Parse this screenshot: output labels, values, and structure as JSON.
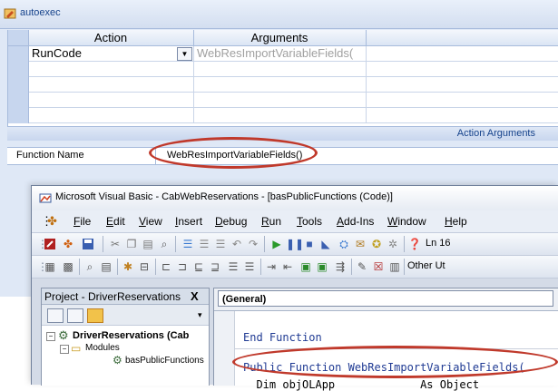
{
  "macro_window": {
    "title": "autoexec",
    "grid": {
      "headers": [
        "Action",
        "Arguments"
      ],
      "rows": [
        {
          "action": "RunCode",
          "arguments": "WebResImportVariableFields("
        }
      ]
    },
    "action_arguments_label": "Action Arguments",
    "function_name_label": "Function Name",
    "function_name_value": "WebResImportVariableFields()"
  },
  "vbe": {
    "title": "Microsoft Visual Basic - CabWebReservations - [basPublicFunctions (Code)]",
    "menu": [
      "File",
      "Edit",
      "View",
      "Insert",
      "Debug",
      "Run",
      "Tools",
      "Add-Ins",
      "Window",
      "Help"
    ],
    "menu_underlines": [
      "F",
      "E",
      "V",
      "I",
      "D",
      "R",
      "T",
      "A",
      "W",
      "H"
    ],
    "toolbar_status": "Ln 16",
    "toolbar2_label": "Other Ut",
    "project_panel": {
      "title": "Project - DriverReservations",
      "close_label": "X",
      "root": "DriverReservations (Cab",
      "folder": "Modules",
      "module": "basPublicFunctions"
    },
    "code": {
      "object_dropdown": "(General)",
      "lines": [
        "End Function",
        "Public Function WebResImportVariableFields(",
        "  Dim objOLApp             As Object"
      ]
    }
  },
  "colors": {
    "highlight_oval": "#c0392b",
    "keyword": "#1f3a93"
  }
}
